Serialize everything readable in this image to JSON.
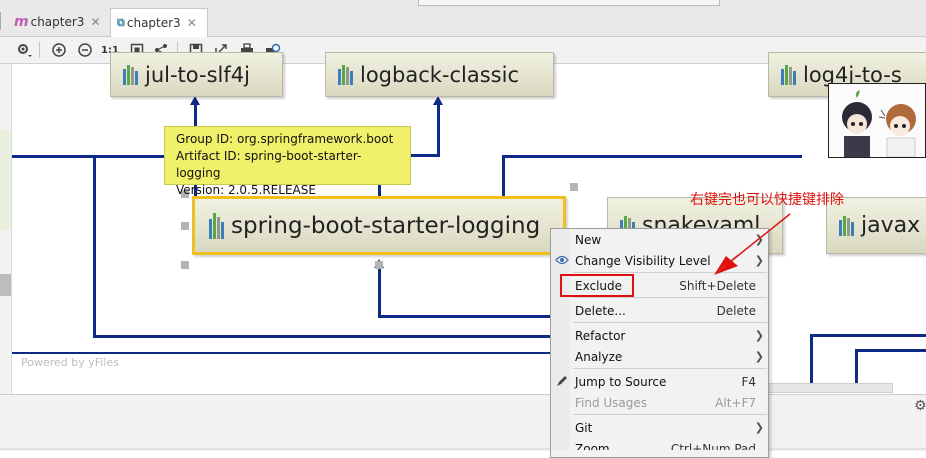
{
  "tabs": [
    {
      "label": "chapter3",
      "icon": "m"
    },
    {
      "label": "chapter3",
      "icon": "diagram-icon"
    }
  ],
  "toolbar": {
    "actual_size_label": "1:1"
  },
  "nodes": {
    "jul": "jul-to-slf4j",
    "logback": "logback-classic",
    "log4j": "log4j-to-s",
    "main": "spring-boot-starter-logging",
    "snakeyaml": "snakeyaml",
    "javax": "javax"
  },
  "tooltip": {
    "group_label": "Group ID: ",
    "group_value": "org.springframework.boot",
    "artifact_label": "Artifact ID: ",
    "artifact_value": "spring-boot-starter-logging",
    "version_label": "Version: ",
    "version_value": "2.0.5.RELEASE"
  },
  "powered_by": "Powered by yFiles",
  "menu": [
    {
      "label": "New",
      "shortcut": "",
      "submenu": true,
      "disabled": false
    },
    {
      "label": "Change Visibility Level",
      "shortcut": "",
      "submenu": true,
      "disabled": false
    },
    {
      "label": "Exclude",
      "shortcut": "Shift+Delete",
      "submenu": false,
      "disabled": false
    },
    {
      "label": "Delete...",
      "shortcut": "Delete",
      "submenu": false,
      "disabled": false
    },
    {
      "label": "Refactor",
      "shortcut": "",
      "submenu": true,
      "disabled": false
    },
    {
      "label": "Analyze",
      "shortcut": "",
      "submenu": true,
      "disabled": false
    },
    {
      "label": "Jump to Source",
      "shortcut": "F4",
      "submenu": false,
      "disabled": false
    },
    {
      "label": "Find Usages",
      "shortcut": "Alt+F7",
      "submenu": false,
      "disabled": true
    },
    {
      "label": "Git",
      "shortcut": "",
      "submenu": true,
      "disabled": false
    },
    {
      "label": "Zoom...",
      "shortcut": "Ctrl+Num Pad",
      "submenu": false,
      "disabled": false
    }
  ],
  "annotation": "右键完也可以快捷键排除",
  "colors": {
    "edge": "#0c2a86",
    "selected_border": "#f0c020",
    "tooltip_bg": "#f0f06a",
    "annotation": "#e01010"
  }
}
